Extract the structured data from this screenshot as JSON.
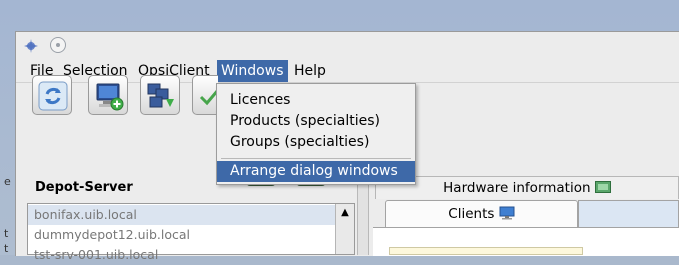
{
  "menubar": {
    "items": [
      "File",
      "Selection",
      "OpsiClient",
      "Windows",
      "Help"
    ],
    "active": "Windows"
  },
  "windows_menu": {
    "items": [
      "Licences",
      "Products (specialties)",
      "Groups (specialties)",
      "Arrange dialog windows"
    ],
    "highlighted": "Arrange dialog windows"
  },
  "toolbar": {
    "icons": [
      "reload-icon",
      "new-client-icon",
      "depot-config-icon",
      "check-icon"
    ]
  },
  "depot_panel": {
    "title": "Depot-Server",
    "items": [
      "bonifax.uib.local",
      "dummydepot12.uib.local",
      "tst-srv-001.uib.local"
    ]
  },
  "tabs": {
    "hardware": "Hardware information",
    "clients": "Clients"
  },
  "left_strip": {
    "text": [
      "e",
      "t",
      "t"
    ]
  },
  "colors": {
    "menu_highlight": "#3e69a8",
    "selected_row": "#dbe4f0",
    "desktop_blue": "#a4b6d2"
  }
}
